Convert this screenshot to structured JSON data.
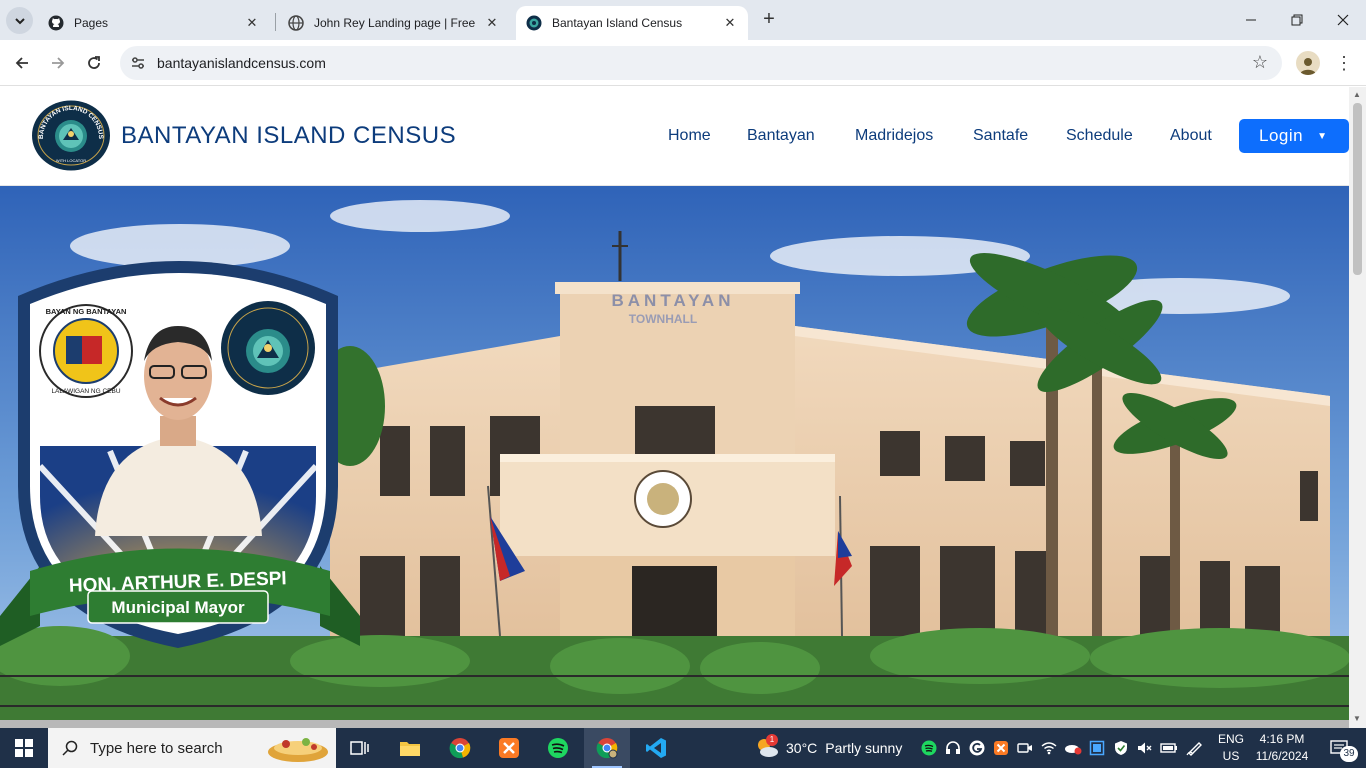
{
  "browser": {
    "tabs": [
      {
        "title": "Pages",
        "icon": "github-icon",
        "active": false
      },
      {
        "title": "John Rey Landing page | Free B",
        "icon": "globe-icon",
        "active": false
      },
      {
        "title": "Bantayan Island Census",
        "icon": "census-logo-icon",
        "active": true
      }
    ],
    "url": "bantayanislandcensus.com"
  },
  "site": {
    "brand": "BANTAYAN ISLAND CENSUS",
    "logo_ring_text": "BANTAYAN ISLAND CENSUS",
    "logo_sub_text": "WITH LOCATOR",
    "menu": [
      "Home",
      "Bantayan",
      "Madridejos",
      "Santafe",
      "Schedule",
      "About"
    ],
    "login_label": "Login"
  },
  "hero": {
    "building_sign_1": "BANTAYAN",
    "building_sign_2": "TOWNHALL",
    "seal_text": "BAYAN NG BANTAYAN",
    "seal_sub": "LALAWIGAN NG CEBU",
    "ribbon_name": "HON. ARTHUR E. DESPI",
    "ribbon_title": "Municipal Mayor"
  },
  "taskbar": {
    "search_placeholder": "Type here to search",
    "weather_temp": "30°C",
    "weather_desc": "Partly sunny",
    "weather_badge": "1",
    "lang_1": "ENG",
    "lang_2": "US",
    "time": "4:16 PM",
    "date": "11/6/2024",
    "notif_count": "39"
  },
  "colors": {
    "brand_blue": "#0d3c7c",
    "login_blue": "#0d6efd",
    "ribbon_green": "#2e7d32",
    "taskbar": "#1f3048"
  }
}
